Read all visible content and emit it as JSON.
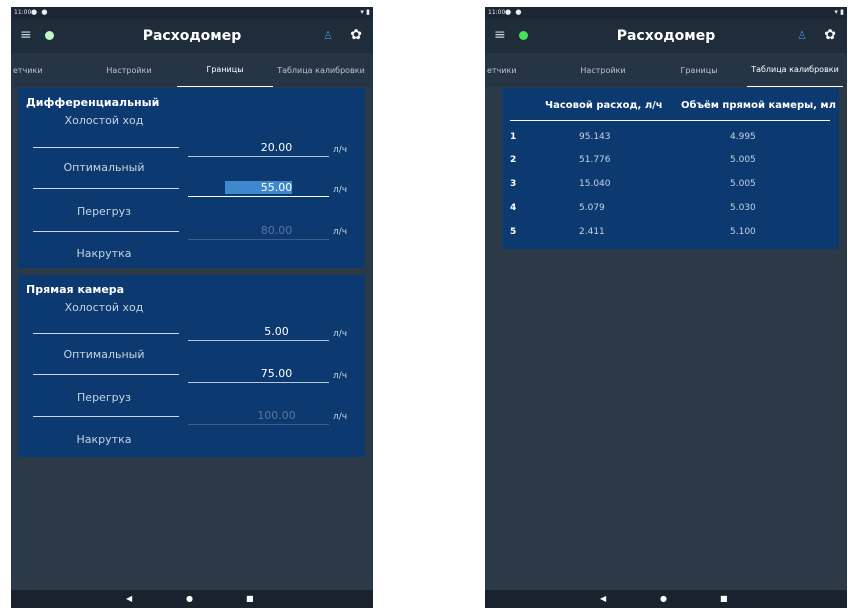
{
  "status": {
    "time": "11:00",
    "notif_icons": "● ●",
    "sys_icons": "▾ ▮"
  },
  "app": {
    "title": "Расходомер",
    "menu_icon": "hamburger",
    "status_dot": "green",
    "user_icon": "user",
    "settings_icon": "gear"
  },
  "tabs": {
    "sensors": "етчики",
    "settings": "Настройки",
    "limits": "Границы",
    "calibration": "Таблица калибровки"
  },
  "left_screen": {
    "active_tab": "limits",
    "differential": {
      "title": "Дифференциальный",
      "idle": {
        "label": "Холостой ход",
        "value": "20.00",
        "unit": "л/ч"
      },
      "optimal": {
        "label": "Оптимальный",
        "value": "55.00",
        "unit": "л/ч"
      },
      "overload": {
        "label": "Перегруз",
        "value": "80.00",
        "unit": "л/ч"
      },
      "tamper": {
        "label": "Накрутка"
      }
    },
    "direct": {
      "title": "Прямая камера",
      "idle": {
        "label": "Холостой ход",
        "value": "5.00",
        "unit": "л/ч"
      },
      "optimal": {
        "label": "Оптимальный",
        "value": "75.00",
        "unit": "л/ч"
      },
      "overload": {
        "label": "Перегруз",
        "value": "100.00",
        "unit": "л/ч"
      },
      "tamper": {
        "label": "Накрутка"
      }
    }
  },
  "right_screen": {
    "active_tab": "calibration",
    "table": {
      "headers": [
        "Часовой расход, л/ч",
        "Объём прямой камеры, мл"
      ],
      "rows": [
        {
          "n": "1",
          "flow": "95.143",
          "volume": "4.995"
        },
        {
          "n": "2",
          "flow": "51.776",
          "volume": "5.005"
        },
        {
          "n": "3",
          "flow": "15.040",
          "volume": "5.005"
        },
        {
          "n": "4",
          "flow": "5.079",
          "volume": "5.030"
        },
        {
          "n": "5",
          "flow": "2.411",
          "volume": "5.100"
        }
      ]
    }
  },
  "nav": {
    "back": "◀",
    "home": "●",
    "recent": "■"
  },
  "colors": {
    "background": "#2c3a48",
    "card": "#0c3a70",
    "status_dot": "#4be05a",
    "accent": "#4b7fd6"
  }
}
